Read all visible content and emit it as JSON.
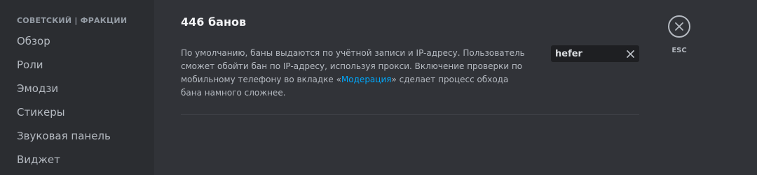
{
  "sidebar": {
    "header": "СОВЕТСКИЙ | ФРАКЦИИ",
    "items": [
      {
        "label": "Обзор"
      },
      {
        "label": "Роли"
      },
      {
        "label": "Эмодзи"
      },
      {
        "label": "Стикеры"
      },
      {
        "label": "Звуковая панель"
      },
      {
        "label": "Виджет"
      }
    ]
  },
  "main": {
    "title": "446 банов",
    "description": {
      "before_link": "По умолчанию, баны выдаются по учётной записи и IP-адресу. Пользователь сможет обойти бан по IP-адресу, используя прокси. Включение проверки по мобильному телефону во вкладке «",
      "link": "Модерация",
      "after_link": "» сделает процесс обхода бана намного сложнее."
    },
    "search": {
      "value": "hefer",
      "clear_icon": "close-icon"
    }
  },
  "close": {
    "icon": "close-circle-icon",
    "label": "ESC"
  },
  "colors": {
    "sidebar_bg": "#2b2d31",
    "content_bg": "#313338",
    "link": "#00a8fc",
    "input_bg": "#1e1f22"
  }
}
